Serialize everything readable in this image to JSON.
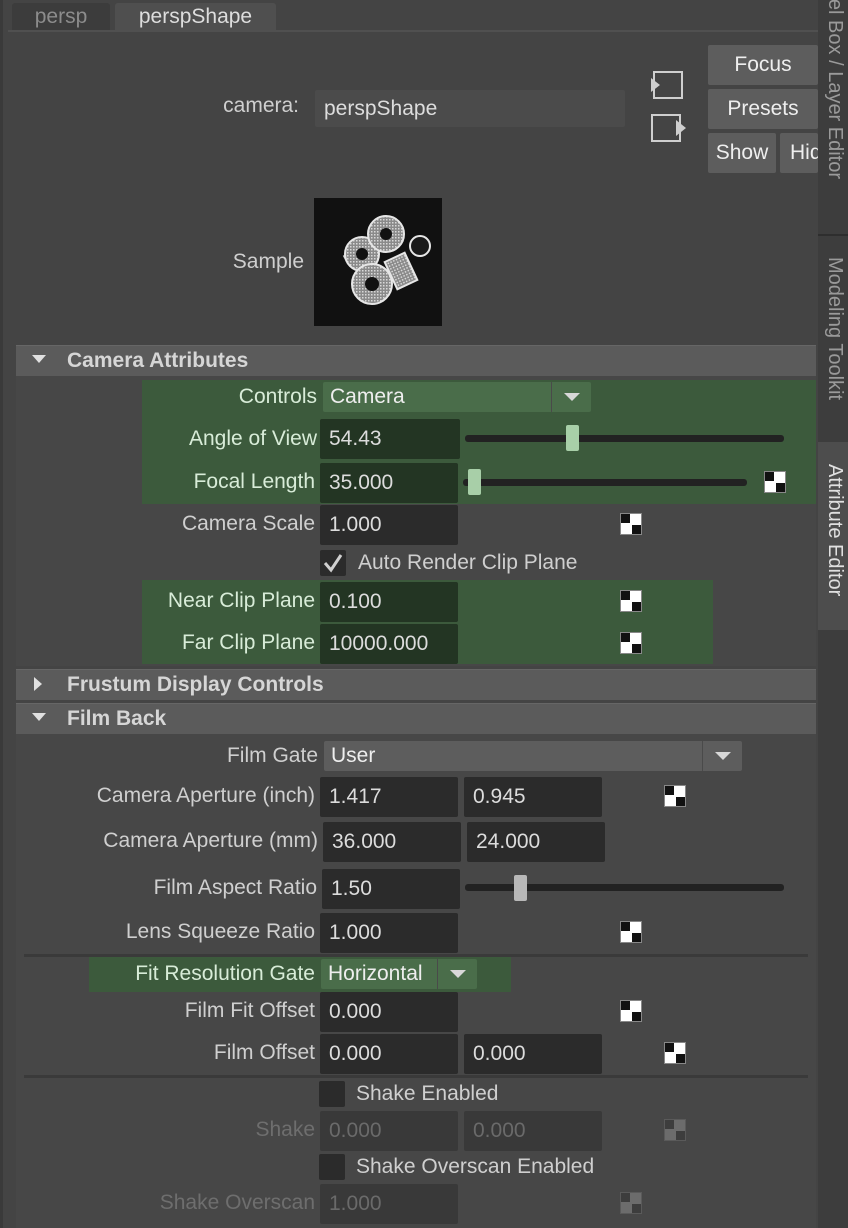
{
  "tabs": {
    "persp": "persp",
    "perspShape": "perspShape"
  },
  "header": {
    "camera_label": "camera:",
    "camera_value": "perspShape",
    "focus_button": "Focus",
    "presets_button": "Presets",
    "show_button": "Show",
    "hide_button": "Hide",
    "sample_label": "Sample"
  },
  "side_tabs": {
    "channel_box": "Channel Box / Layer Editor",
    "modeling_toolkit": "Modeling Toolkit",
    "attribute_editor": "Attribute Editor"
  },
  "camera_attributes": {
    "title": "Camera Attributes",
    "controls_label": "Controls",
    "controls_value": "Camera",
    "angle_of_view_label": "Angle of View",
    "angle_of_view_value": "54.43",
    "angle_of_view_slider": 0.33,
    "focal_length_label": "Focal Length",
    "focal_length_value": "35.000",
    "focal_length_slider": 0.02,
    "camera_scale_label": "Camera Scale",
    "camera_scale_value": "1.000",
    "auto_render_clip_label": "Auto Render Clip Plane",
    "auto_render_clip_checked": true,
    "near_clip_label": "Near Clip Plane",
    "near_clip_value": "0.100",
    "far_clip_label": "Far Clip Plane",
    "far_clip_value": "10000.000"
  },
  "frustum": {
    "title": "Frustum Display Controls"
  },
  "film_back": {
    "title": "Film Back",
    "film_gate_label": "Film Gate",
    "film_gate_value": "User",
    "aperture_inch_label": "Camera Aperture (inch)",
    "aperture_inch_x": "1.417",
    "aperture_inch_y": "0.945",
    "aperture_mm_label": "Camera Aperture (mm)",
    "aperture_mm_x": "36.000",
    "aperture_mm_y": "24.000",
    "film_aspect_label": "Film Aspect Ratio",
    "film_aspect_value": "1.50",
    "film_aspect_slider": 0.16,
    "lens_squeeze_label": "Lens Squeeze Ratio",
    "lens_squeeze_value": "1.000",
    "fit_gate_label": "Fit Resolution Gate",
    "fit_gate_value": "Horizontal",
    "film_fit_offset_label": "Film Fit Offset",
    "film_fit_offset_value": "0.000",
    "film_offset_label": "Film Offset",
    "film_offset_x": "0.000",
    "film_offset_y": "0.000",
    "shake_enabled_label": "Shake Enabled",
    "shake_label": "Shake",
    "shake_x": "0.000",
    "shake_y": "0.000",
    "shake_overscan_enabled_label": "Shake Overscan Enabled",
    "shake_overscan_label": "Shake Overscan",
    "shake_overscan_value": "1.000"
  }
}
